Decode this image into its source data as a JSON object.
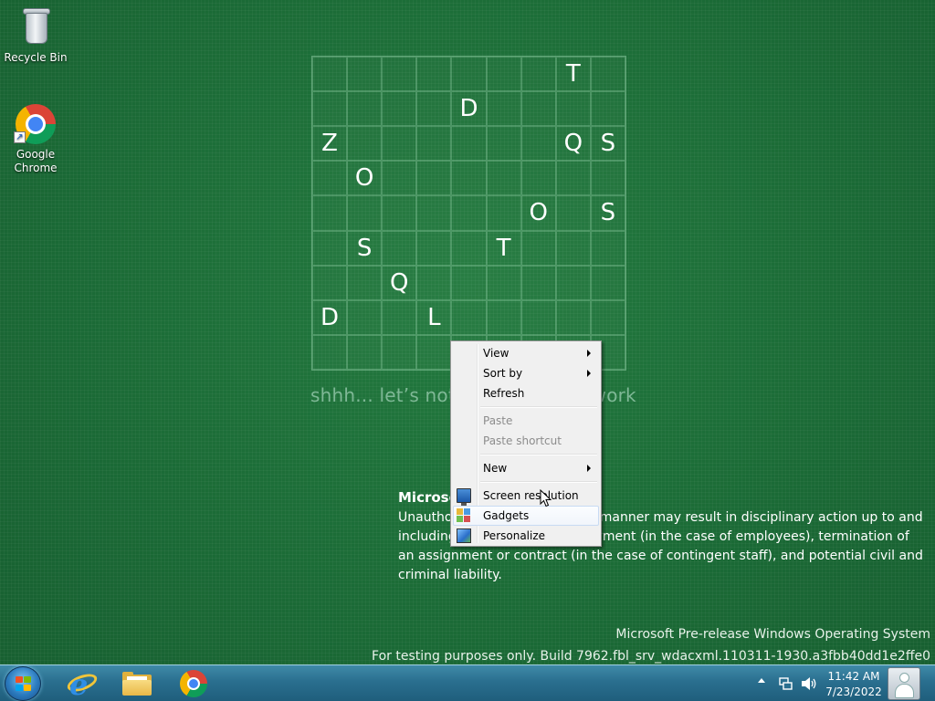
{
  "desktop": {
    "icons": [
      {
        "label": "Recycle Bin",
        "icon": "recycle-bin-icon"
      },
      {
        "label": "Google\nChrome",
        "icon": "chrome-icon"
      }
    ]
  },
  "letter_grid": {
    "rows": [
      [
        "",
        "",
        "",
        "",
        "",
        "",
        "",
        "T",
        ""
      ],
      [
        "",
        "",
        "",
        "",
        "D",
        "",
        "",
        "",
        ""
      ],
      [
        "Z",
        "",
        "",
        "",
        "",
        "",
        "",
        "Q",
        "S"
      ],
      [
        "",
        "O",
        "",
        "",
        "",
        "",
        "",
        "",
        ""
      ],
      [
        "",
        "",
        "",
        "",
        "",
        "",
        "O",
        "",
        "S"
      ],
      [
        "",
        "S",
        "",
        "",
        "",
        "T",
        "",
        "",
        ""
      ],
      [
        "",
        "",
        "Q",
        "",
        "",
        "",
        "",
        "",
        ""
      ],
      [
        "D",
        "",
        "",
        "L",
        "",
        "",
        "",
        "",
        ""
      ],
      [
        "",
        "",
        "",
        "",
        "",
        "",
        "",
        "",
        ""
      ]
    ],
    "tagline": "shhh... let’s not leak our hard work"
  },
  "confidential": {
    "title": "Microsoft Confidential",
    "body": "Unauthorized disclosure in any manner may result in disciplinary action up to and including termination of employment (in the case of employees), termination of an assignment or contract (in the case of contingent staff), and potential civil and criminal liability."
  },
  "watermark": {
    "line1": "Microsoft Pre-release Windows Operating System",
    "line2": "For testing purposes only. Build 7962.fbl_srv_wdacxml.110311-1930.a3fbb40dd1e2ffe0"
  },
  "context_menu": {
    "view": "View",
    "sort_by": "Sort by",
    "refresh": "Refresh",
    "paste": "Paste",
    "paste_shortcut": "Paste shortcut",
    "new": "New",
    "screen_resolution": "Screen resolution",
    "gadgets": "Gadgets",
    "personalize": "Personalize"
  },
  "taskbar": {
    "pinned": [
      "internet-explorer-icon",
      "windows-explorer-icon",
      "chrome-icon"
    ],
    "clock_time": "11:42 AM",
    "clock_date": "7/23/2022"
  }
}
